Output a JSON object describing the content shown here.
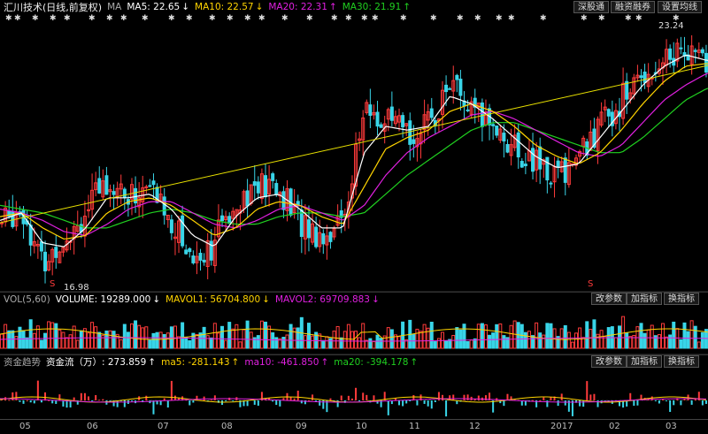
{
  "top": {
    "stock": "汇川技术",
    "mode": "(日线,前复权)",
    "ma_label": "MA",
    "ma5": "MA5: 22.65",
    "ma5_arrow": "↓",
    "ma10": "MA10: 22.57",
    "ma10_arrow": "↓",
    "ma20": "MA20: 22.31",
    "ma20_arrow": "↑",
    "ma30": "MA30: 21.91",
    "ma30_arrow": "↑",
    "btn_market": "深股通",
    "btn_margin": "融资融券",
    "btn_ma": "设置均线"
  },
  "price": {
    "high_label": "23.24",
    "low_label": "16.98",
    "marker_low": "S",
    "marker_mid": "S"
  },
  "volume": {
    "name": "VOL(5,60)",
    "volume": "VOLUME: 19289.000",
    "volume_arrow": "↓",
    "mavol1": "MAVOL1: 56704.800",
    "mavol1_arrow": "↓",
    "mavol2": "MAVOL2: 69709.883",
    "mavol2_arrow": "↓",
    "btn_params": "改参数",
    "btn_add": "加指标",
    "btn_switch": "换指标"
  },
  "flow": {
    "name": "资金趋势",
    "value": "资金流（万）: 273.859",
    "value_arrow": "↑",
    "ma5": "ma5: -281.143",
    "ma5_arrow": "↑",
    "ma10": "ma10: -461.850",
    "ma10_arrow": "↑",
    "ma20": "ma20: -394.178",
    "ma20_arrow": "↑",
    "btn_params": "改参数",
    "btn_add": "加指标",
    "btn_switch": "换指标"
  },
  "axis": {
    "ticks": [
      "05",
      "06",
      "07",
      "08",
      "09",
      "10",
      "11",
      "12",
      "2017",
      "02",
      "03"
    ]
  },
  "colors": {
    "up": "#ff3b3b",
    "down": "#39d5e8",
    "ma5": "#ffffff",
    "ma10": "#ffd400",
    "ma20": "#e020e0",
    "ma30": "#20d020",
    "trend": "#e8e000"
  },
  "chart_data": {
    "type": "candlestick",
    "price_range": [
      16.98,
      23.24
    ],
    "close_path": [
      18.3,
      18.8,
      17.2,
      18.0,
      18.6,
      19.5,
      19.0,
      19.3,
      18.4,
      17.4,
      17.8,
      19.0,
      19.3,
      19.2,
      18.4,
      18.0,
      18.4,
      21.3,
      21.0,
      20.7,
      20.9,
      22.1,
      21.2,
      21.0,
      20.3,
      19.9,
      19.6,
      20.1,
      20.9,
      21.6,
      22.3,
      22.7,
      23.0,
      22.5
    ],
    "ma5_path": [
      18.4,
      18.6,
      17.8,
      17.7,
      18.2,
      19.0,
      19.0,
      19.1,
      18.7,
      18.0,
      17.7,
      18.5,
      19.0,
      19.1,
      18.7,
      18.2,
      18.2,
      20.2,
      20.9,
      20.8,
      20.9,
      21.7,
      21.5,
      21.1,
      20.6,
      20.1,
      19.8,
      19.9,
      20.6,
      21.3,
      22.0,
      22.5,
      22.8,
      22.65
    ],
    "ma10_path": [
      18.5,
      18.6,
      18.2,
      17.9,
      18.0,
      18.6,
      18.9,
      19.0,
      18.8,
      18.4,
      18.0,
      18.2,
      18.7,
      18.9,
      18.8,
      18.5,
      18.3,
      19.3,
      20.3,
      20.6,
      20.8,
      21.3,
      21.5,
      21.3,
      20.9,
      20.4,
      20.1,
      19.9,
      20.2,
      20.8,
      21.5,
      22.1,
      22.5,
      22.57
    ],
    "ma20_path": [
      18.7,
      18.6,
      18.4,
      18.1,
      18.0,
      18.3,
      18.7,
      18.9,
      18.9,
      18.6,
      18.3,
      18.2,
      18.4,
      18.7,
      18.8,
      18.6,
      18.4,
      18.8,
      19.6,
      20.2,
      20.6,
      20.9,
      21.2,
      21.3,
      21.1,
      20.8,
      20.5,
      20.2,
      20.1,
      20.4,
      21.0,
      21.6,
      22.0,
      22.31
    ],
    "ma30_path": [
      18.8,
      18.7,
      18.6,
      18.4,
      18.2,
      18.2,
      18.4,
      18.6,
      18.7,
      18.6,
      18.4,
      18.3,
      18.3,
      18.5,
      18.6,
      18.6,
      18.5,
      18.6,
      19.1,
      19.6,
      20.0,
      20.4,
      20.8,
      21.0,
      21.0,
      20.8,
      20.6,
      20.4,
      20.2,
      20.2,
      20.6,
      21.1,
      21.6,
      21.91
    ]
  }
}
